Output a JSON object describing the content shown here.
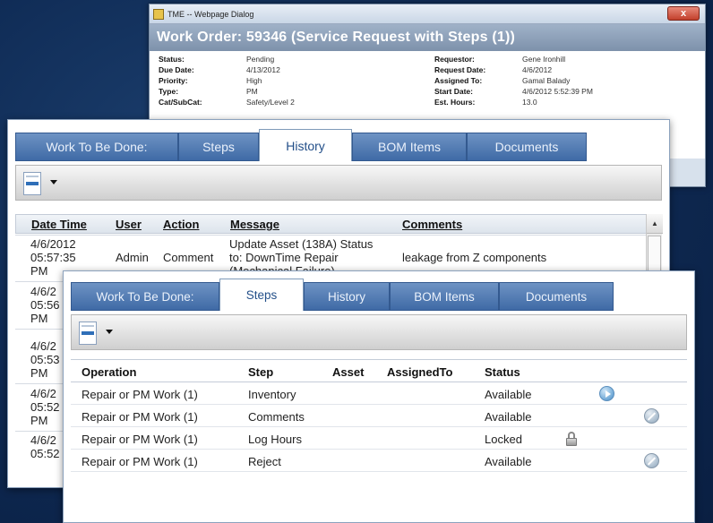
{
  "dialog": {
    "window_title": "TME -- Webpage Dialog",
    "close_glyph": "x",
    "header": "Work Order: 59346 (Service Request with Steps (1))",
    "fields_left": [
      {
        "label": "Status:",
        "value": "Pending"
      },
      {
        "label": "Due Date:",
        "value": "4/13/2012"
      },
      {
        "label": "Priority:",
        "value": "High"
      },
      {
        "label": "Type:",
        "value": "PM"
      },
      {
        "label": "Cat/SubCat:",
        "value": "Safety/Level 2"
      }
    ],
    "fields_right": [
      {
        "label": "Requestor:",
        "value": "Gene Ironhill"
      },
      {
        "label": "Request Date:",
        "value": "4/6/2012"
      },
      {
        "label": "Assigned To:",
        "value": "Gamal Balady"
      },
      {
        "label": "Start Date:",
        "value": "4/6/2012 5:52:39 PM"
      },
      {
        "label": "Est. Hours:",
        "value": "13.0"
      }
    ]
  },
  "history_panel": {
    "tabs": [
      "Work To Be Done:",
      "Steps",
      "History",
      "BOM Items",
      "Documents"
    ],
    "active_tab": "History",
    "columns": [
      "Date Time",
      "User",
      "Action",
      "Message",
      "Comments"
    ],
    "rows": [
      {
        "date": [
          "4/6/2012",
          "05:57:35",
          "PM"
        ],
        "user": "Admin",
        "action": "Comment",
        "message": [
          "Update Asset (138A) Status",
          "to: DownTime Repair",
          "(Mechanical Failure)"
        ],
        "comments": "leakage from Z components"
      },
      {
        "date": [
          "4/6/2",
          "05:56",
          "PM"
        ]
      },
      {
        "date": [
          "4/6/2",
          "05:53",
          "PM"
        ]
      },
      {
        "date": [
          "4/6/2",
          "05:52",
          "PM"
        ]
      },
      {
        "date": [
          "4/6/2",
          "05:52"
        ]
      }
    ]
  },
  "steps_panel": {
    "tabs": [
      "Work To Be Done:",
      "Steps",
      "History",
      "BOM Items",
      "Documents"
    ],
    "active_tab": "Steps",
    "columns": [
      "Operation",
      "Step",
      "Asset",
      "AssignedTo",
      "Status"
    ],
    "rows": [
      {
        "operation": "Repair or PM Work (1)",
        "step": "Inventory",
        "asset": "",
        "assigned_to": "",
        "status": "Available",
        "icon": "play-icon"
      },
      {
        "operation": "Repair or PM Work (1)",
        "step": "Comments",
        "asset": "",
        "assigned_to": "",
        "status": "Available",
        "icon": "not-allowed-icon"
      },
      {
        "operation": "Repair or PM Work (1)",
        "step": "Log Hours",
        "asset": "",
        "assigned_to": "",
        "status": "Locked",
        "icon": "lock-icon"
      },
      {
        "operation": "Repair or PM Work (1)",
        "step": "Reject",
        "asset": "",
        "assigned_to": "",
        "status": "Available",
        "icon": "not-allowed-icon"
      }
    ]
  }
}
